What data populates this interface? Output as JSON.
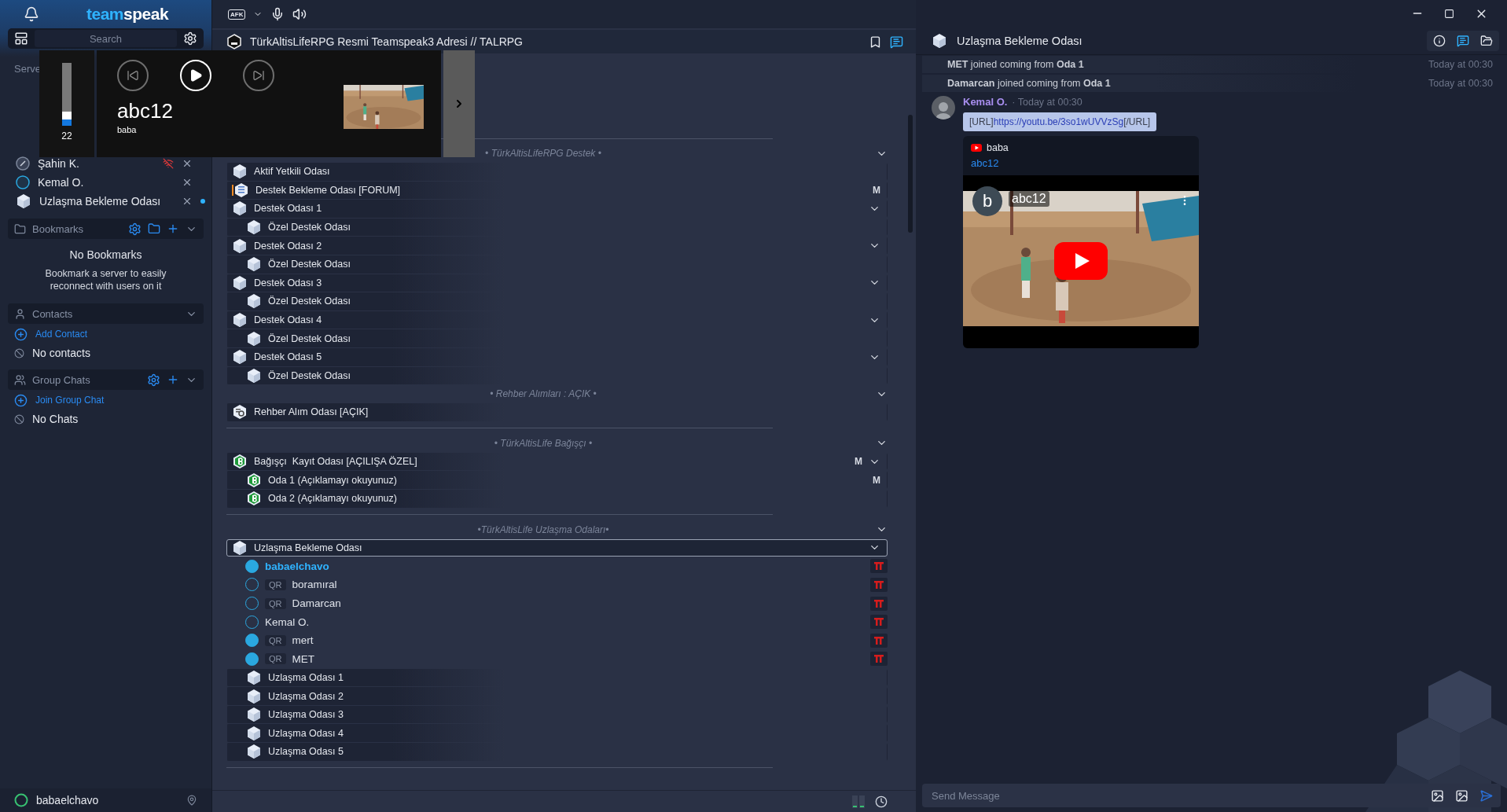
{
  "sidebar": {
    "logo": {
      "first": "team",
      "second": "speak"
    },
    "search": {
      "placeholder": "Search"
    },
    "servers_label": "Serve",
    "servers": [
      {
        "kind": "compass",
        "name": "Şahin K.",
        "signal_lost": true,
        "unread": false
      },
      {
        "kind": "ring",
        "name": "Kemal O.",
        "signal_lost": false,
        "unread": false
      },
      {
        "kind": "cube",
        "name": "Uzlaşma Bekleme Odası",
        "signal_lost": false,
        "unread": true
      }
    ],
    "bookmarks": {
      "title": "Bookmarks",
      "empty_title": "No Bookmarks",
      "empty_text": "Bookmark a server to easily reconnect with users on it"
    },
    "contacts": {
      "title": "Contacts",
      "action": "Add Contact",
      "empty": "No contacts"
    },
    "group_chats": {
      "title": "Group Chats",
      "action": "Join Group Chat",
      "empty": "No Chats"
    },
    "user": {
      "name": "babaelchavo"
    }
  },
  "toolbar": {
    "afk": "AFK"
  },
  "server": {
    "title": "TürkAltisLifeRPG Resmi Teamspeak3 Adresi // TALRPG"
  },
  "tree": [
    {
      "kind": "divider"
    },
    {
      "kind": "header",
      "text": "• TürkAltisLifeRPG Destek •",
      "expanded": true
    },
    {
      "kind": "cube",
      "name": "Aktif Yetkili Odası",
      "selected": false
    },
    {
      "kind": "forum",
      "name": "Destek Bekleme Odası [FORUM]",
      "badge": "M",
      "selected": false
    },
    {
      "kind": "cube",
      "name": "Destek Odası 1",
      "selected": false,
      "expanded": true,
      "children": [
        {
          "kind": "cube",
          "name": "Özel Destek Odası",
          "selected": false
        }
      ]
    },
    {
      "kind": "cube",
      "name": "Destek Odası 2",
      "selected": false,
      "expanded": true,
      "children": [
        {
          "kind": "cube",
          "name": "Özel Destek Odası",
          "selected": false
        }
      ]
    },
    {
      "kind": "cube",
      "name": "Destek Odası 3",
      "selected": false,
      "expanded": true,
      "children": [
        {
          "kind": "cube",
          "name": "Özel Destek Odası",
          "selected": false
        }
      ]
    },
    {
      "kind": "cube",
      "name": "Destek Odası 4",
      "selected": false,
      "expanded": true,
      "children": [
        {
          "kind": "cube",
          "name": "Özel Destek Odası",
          "selected": false
        }
      ]
    },
    {
      "kind": "cube",
      "name": "Destek Odası 5",
      "selected": false,
      "expanded": true,
      "children": [
        {
          "kind": "cube",
          "name": "Özel Destek Odası",
          "selected": false
        }
      ]
    },
    {
      "kind": "header",
      "text": "• Rehber Alımları : AÇIK •",
      "expanded": true
    },
    {
      "kind": "search",
      "name": "Rehber Alım Odası [AÇIK]",
      "selected": false
    },
    {
      "kind": "divider"
    },
    {
      "kind": "header",
      "text": "• TürkAltisLife Bağışçı •",
      "expanded": true
    },
    {
      "kind": "donor",
      "name": "Bağışçı  Kayıt Odası [AÇILIŞA ÖZEL]",
      "badge": "M",
      "selected": false,
      "expanded": true,
      "children": [
        {
          "kind": "donor",
          "name": "Oda 1 (Açıklamayı okuyunuz)",
          "badge": "M",
          "selected": false
        },
        {
          "kind": "donor",
          "name": "Oda 2 (Açıklamayı okuyunuz)",
          "selected": false
        }
      ]
    },
    {
      "kind": "divider"
    },
    {
      "kind": "header",
      "text": "•TürkAltisLife Uzlaşma Odaları•",
      "expanded": true
    },
    {
      "kind": "cube",
      "name": "Uzlaşma Bekleme Odası",
      "selected": true,
      "expanded": true,
      "children": [
        {
          "kind": "user",
          "name": "babaelchavo",
          "talking": true,
          "self": true
        },
        {
          "kind": "user",
          "tag": "QR",
          "name": "boramıral",
          "talking": false,
          "self": false
        },
        {
          "kind": "user",
          "tag": "QR",
          "name": "Damarcan",
          "talking": false,
          "self": false
        },
        {
          "kind": "user",
          "name": "Kemal O.",
          "talking": false,
          "self": false
        },
        {
          "kind": "user",
          "tag": "QR",
          "name": "mert",
          "talking": true,
          "self": false
        },
        {
          "kind": "user",
          "tag": "QR",
          "name": "MET",
          "talking": true,
          "self": false
        },
        {
          "kind": "cube",
          "name": "Uzlaşma Odası 1",
          "selected": false
        },
        {
          "kind": "cube",
          "name": "Uzlaşma Odası 2",
          "selected": false
        },
        {
          "kind": "cube",
          "name": "Uzlaşma Odası 3",
          "selected": false
        },
        {
          "kind": "cube",
          "name": "Uzlaşma Odası 4",
          "selected": false
        },
        {
          "kind": "cube",
          "name": "Uzlaşma Odası 5",
          "selected": false
        }
      ]
    },
    {
      "kind": "divider"
    }
  ],
  "media": {
    "level": 0.22,
    "volume": "22",
    "title": "abc12",
    "artist": "baba"
  },
  "chat": {
    "title": "Uzlaşma Bekleme Odası",
    "events": [
      {
        "text": "**MET** joined coming from **Oda 1**",
        "time": "Today at 00:30"
      },
      {
        "text": "**Damarcan** joined coming from **Oda 1**",
        "time": "Today at 00:30"
      }
    ],
    "message": {
      "author": "Kemal O.",
      "time": "· Today at 00:30",
      "prefix": "[URL]",
      "link": "https://youtu.be/3so1wUVVzSg",
      "suffix": "[/URL]",
      "embed": {
        "source": "baba",
        "title": "abc12",
        "video_avatar": "b",
        "video_title": "abc12"
      }
    },
    "input": {
      "placeholder": "Send Message"
    }
  }
}
